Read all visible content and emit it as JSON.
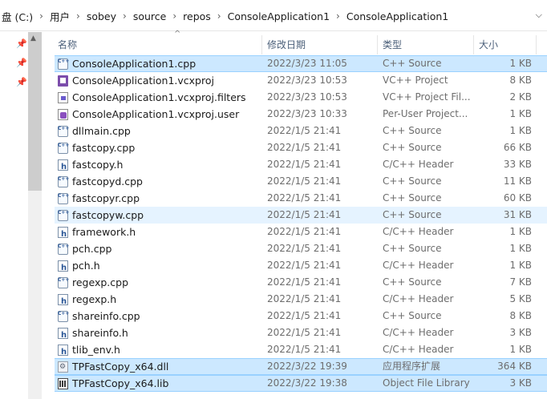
{
  "breadcrumb": {
    "items": [
      "盘 (C:)",
      "用户",
      "sobey",
      "source",
      "repos",
      "ConsoleApplication1",
      "ConsoleApplication1"
    ]
  },
  "columns": {
    "name": "名称",
    "date": "修改日期",
    "type": "类型",
    "size": "大小"
  },
  "files": [
    {
      "name": "ConsoleApplication1.cpp",
      "date": "2022/3/23 11:05",
      "type": "C++ Source",
      "size": "1 KB",
      "icon": "cpp"
    },
    {
      "name": "ConsoleApplication1.vcxproj",
      "date": "2022/3/23 10:53",
      "type": "VC++ Project",
      "size": "8 KB",
      "icon": "proj"
    },
    {
      "name": "ConsoleApplication1.vcxproj.filters",
      "date": "2022/3/23 10:53",
      "type": "VC++ Project Fil...",
      "size": "2 KB",
      "icon": "filt"
    },
    {
      "name": "ConsoleApplication1.vcxproj.user",
      "date": "2022/3/23 10:33",
      "type": "Per-User Project...",
      "size": "1 KB",
      "icon": "user"
    },
    {
      "name": "dllmain.cpp",
      "date": "2022/1/5 21:41",
      "type": "C++ Source",
      "size": "1 KB",
      "icon": "cpp"
    },
    {
      "name": "fastcopy.cpp",
      "date": "2022/1/5 21:41",
      "type": "C++ Source",
      "size": "66 KB",
      "icon": "cpp"
    },
    {
      "name": "fastcopy.h",
      "date": "2022/1/5 21:41",
      "type": "C/C++ Header",
      "size": "33 KB",
      "icon": "h"
    },
    {
      "name": "fastcopyd.cpp",
      "date": "2022/1/5 21:41",
      "type": "C++ Source",
      "size": "11 KB",
      "icon": "cpp"
    },
    {
      "name": "fastcopyr.cpp",
      "date": "2022/1/5 21:41",
      "type": "C++ Source",
      "size": "60 KB",
      "icon": "cpp"
    },
    {
      "name": "fastcopyw.cpp",
      "date": "2022/1/5 21:41",
      "type": "C++ Source",
      "size": "31 KB",
      "icon": "cpp"
    },
    {
      "name": "framework.h",
      "date": "2022/1/5 21:41",
      "type": "C/C++ Header",
      "size": "1 KB",
      "icon": "h"
    },
    {
      "name": "pch.cpp",
      "date": "2022/1/5 21:41",
      "type": "C++ Source",
      "size": "1 KB",
      "icon": "cpp"
    },
    {
      "name": "pch.h",
      "date": "2022/1/5 21:41",
      "type": "C/C++ Header",
      "size": "1 KB",
      "icon": "h"
    },
    {
      "name": "regexp.cpp",
      "date": "2022/1/5 21:41",
      "type": "C++ Source",
      "size": "7 KB",
      "icon": "cpp"
    },
    {
      "name": "regexp.h",
      "date": "2022/1/5 21:41",
      "type": "C/C++ Header",
      "size": "5 KB",
      "icon": "h"
    },
    {
      "name": "shareinfo.cpp",
      "date": "2022/1/5 21:41",
      "type": "C++ Source",
      "size": "8 KB",
      "icon": "cpp"
    },
    {
      "name": "shareinfo.h",
      "date": "2022/1/5 21:41",
      "type": "C/C++ Header",
      "size": "3 KB",
      "icon": "h"
    },
    {
      "name": "tlib_env.h",
      "date": "2022/1/5 21:41",
      "type": "C/C++ Header",
      "size": "1 KB",
      "icon": "h"
    },
    {
      "name": "TPFastCopy_x64.dll",
      "date": "2022/3/22 19:39",
      "type": "应用程序扩展",
      "size": "364 KB",
      "icon": "dll"
    },
    {
      "name": "TPFastCopy_x64.lib",
      "date": "2022/3/22 19:38",
      "type": "Object File Library",
      "size": "3 KB",
      "icon": "lib"
    }
  ],
  "states": {
    "selected_rows": [
      0,
      18,
      19
    ],
    "hover_rows": [
      9
    ]
  }
}
